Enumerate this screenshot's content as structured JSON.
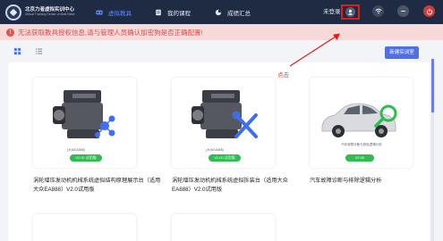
{
  "app": {
    "logo_title": "北京力者虚拟实训中心",
    "logo_subtitle": "Virtual Training Center of Beili Nebe"
  },
  "nav": {
    "items": [
      {
        "label": "虚拟教具",
        "icon": "vr-box-icon",
        "active": true
      },
      {
        "label": "我的课程",
        "icon": "book-icon",
        "active": false
      },
      {
        "label": "成绩汇总",
        "icon": "chart-icon",
        "active": false
      }
    ],
    "login_status": "未登录"
  },
  "banner": {
    "message": "无法获取教具授权信息,请与管理人员确认加密狗是否正确配置!"
  },
  "toolbar": {
    "new_button": "新建实训室"
  },
  "annotation": {
    "text": "点击"
  },
  "cards": [
    {
      "title": "涡轮增压发动机机械系统虚拟结构原理展示台（适用大众EA888）V2.0试用版",
      "badge": "V2.00 试用版",
      "image_label": "(大众EA888)"
    },
    {
      "title": "涡轮增压发动机机械系统虚拟拆装台（适用大众EA888）V2.0试用版",
      "badge": "V2.00 试用版",
      "image_label": "(大众EA888)"
    },
    {
      "title": "汽车故障诊断与排除逻辑分析",
      "badge": "V2.00",
      "image_label": "汽车故障诊断与排除逻辑分析"
    },
    {
      "title": "",
      "badge": "",
      "image_label": ""
    },
    {
      "title": "",
      "badge": "",
      "image_label": ""
    }
  ],
  "colors": {
    "nav_bg": "#1f2a43",
    "active_nav": "#5d8bff",
    "error_text": "#e04b4b",
    "error_bg": "#f6d9d9",
    "primary_button": "#4f6fe7",
    "badge_green": "#2ebd4e",
    "highlight_red": "#e21b1b"
  }
}
